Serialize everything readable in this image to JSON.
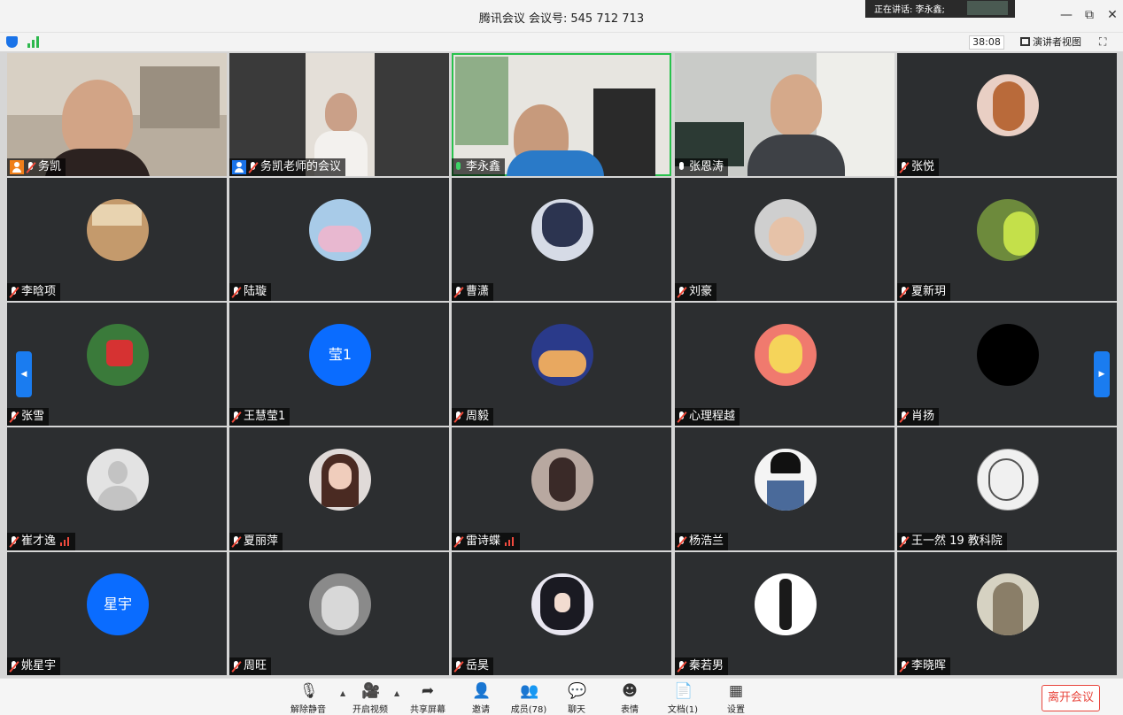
{
  "window": {
    "title_label": "腾讯会议 会议号:",
    "meeting_id": "545 712 713",
    "speaking": "正在讲话: 李永鑫;"
  },
  "toolbar": {
    "timer": "38:08",
    "speaker_view": "演讲者视图"
  },
  "participants": [
    {
      "name": "务凯",
      "type": "video",
      "host": "orange",
      "mic": "muted"
    },
    {
      "name": "务凯老师的会议",
      "type": "video",
      "host": "blue",
      "mic": "muted"
    },
    {
      "name": "李永鑫",
      "type": "video",
      "mic": "on",
      "active": true
    },
    {
      "name": "张恩涛",
      "type": "video",
      "mic": "plain"
    },
    {
      "name": "张悦",
      "type": "avatar",
      "mic": "muted"
    },
    {
      "name": "李晗项",
      "type": "avatar",
      "mic": "muted"
    },
    {
      "name": "陆璇",
      "type": "avatar",
      "mic": "muted"
    },
    {
      "name": "曹潇",
      "type": "avatar",
      "mic": "muted"
    },
    {
      "name": "刘豪",
      "type": "avatar",
      "mic": "muted"
    },
    {
      "name": "夏新玥",
      "type": "avatar",
      "mic": "muted"
    },
    {
      "name": "张雪",
      "type": "avatar",
      "mic": "muted"
    },
    {
      "name": "王慧莹1",
      "type": "text",
      "avatar_text": "莹1",
      "mic": "muted"
    },
    {
      "name": "周毅",
      "type": "avatar",
      "mic": "muted"
    },
    {
      "name": "心理程越",
      "type": "avatar",
      "mic": "muted"
    },
    {
      "name": "肖扬",
      "type": "avatar",
      "mic": "muted"
    },
    {
      "name": "崔才逸",
      "type": "default",
      "mic": "muted",
      "signal": true
    },
    {
      "name": "夏丽萍",
      "type": "avatar",
      "mic": "muted"
    },
    {
      "name": "雷诗蝶",
      "type": "avatar",
      "mic": "muted",
      "signal": true
    },
    {
      "name": "杨浩兰",
      "type": "avatar",
      "mic": "muted"
    },
    {
      "name": "王一然 19 教科院",
      "type": "avatar",
      "mic": "muted"
    },
    {
      "name": "姚星宇",
      "type": "text",
      "avatar_text": "星宇",
      "mic": "muted"
    },
    {
      "name": "周旺",
      "type": "avatar",
      "mic": "muted"
    },
    {
      "name": "岳昊",
      "type": "avatar",
      "mic": "muted"
    },
    {
      "name": "秦若男",
      "type": "avatar",
      "mic": "muted"
    },
    {
      "name": "李晓晖",
      "type": "avatar",
      "mic": "muted"
    }
  ],
  "bottom": {
    "unmute": "解除静音",
    "start_video": "开启视频",
    "share_screen": "共享屏幕",
    "invite": "邀请",
    "members": "成员(78)",
    "chat": "聊天",
    "reactions": "表情",
    "docs": "文档(1)",
    "settings": "设置",
    "leave": "离开会议"
  },
  "colors": {
    "accent": "#1a73e8",
    "leave": "#e8453c",
    "active_speaker": "#27c24c",
    "tile_bg": "#2c2e30"
  }
}
